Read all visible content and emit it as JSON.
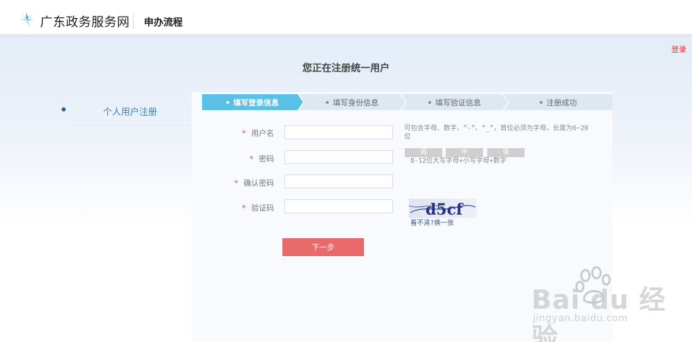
{
  "header": {
    "site_name": "广东政务服务网",
    "page_title": "申办流程",
    "login_link": "登录"
  },
  "main": {
    "heading": "您正在注册统一用户"
  },
  "side_nav": {
    "items": [
      {
        "label": "个人用户注册"
      }
    ]
  },
  "steps": [
    {
      "label": "填写登录信息",
      "active": true
    },
    {
      "label": "填写身份信息",
      "active": false
    },
    {
      "label": "填写验证信息",
      "active": false
    },
    {
      "label": "注册成功",
      "active": false
    }
  ],
  "form": {
    "required_mark": "*",
    "username": {
      "label": "用户名",
      "value": "",
      "hint": "可包含字母、数字、“-”、“_”，首位必须为字母，长度为6~20位"
    },
    "password": {
      "label": "密码",
      "value": "",
      "strength_levels": [
        "弱",
        "中",
        "强"
      ],
      "hint": "8-12位大写字母+小写字母+数字"
    },
    "confirm_password": {
      "label": "确认密码",
      "value": ""
    },
    "captcha": {
      "label": "验证码",
      "value": "",
      "image_text": "d5cf",
      "refresh_link": "看不清?换一张"
    },
    "next_button": "下一步"
  },
  "watermark": {
    "brand": "Bai du 经验",
    "url": "jingyan.baidu.com"
  },
  "colors": {
    "step_active": "#5bc0e8",
    "step_inactive": "#dde8f1",
    "accent_red": "#e96a6a",
    "required": "#e23b3b",
    "nav_link": "#3a7fc1"
  }
}
